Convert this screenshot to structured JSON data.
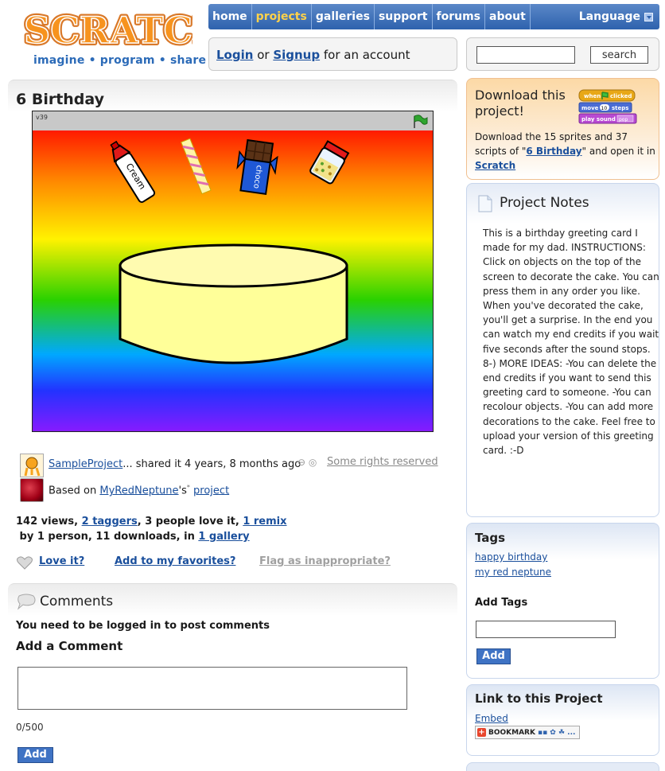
{
  "header": {
    "logo_text": "SCRATCH",
    "tagline": "imagine • program • share",
    "nav": {
      "home": "home",
      "projects": "projects",
      "galleries": "galleries",
      "support": "support",
      "forums": "forums",
      "about": "about",
      "language": "Language"
    },
    "login_link": "Login",
    "or_text": " or ",
    "signup_link": "Signup",
    "account_text": " for an account",
    "search_button": "search"
  },
  "project": {
    "title": "6 Birthday",
    "stage_version": "v39",
    "sprite_labels": {
      "cream": "Cream",
      "chocolate": "choco"
    },
    "share": {
      "user": "SampleProject",
      "ellipsis": "...",
      "shared_text": " shared it 4 years, 8 months ago",
      "rights_icon": "cc-icon",
      "rights_text": "Some rights reserved"
    },
    "based_on": {
      "prefix": "Based on ",
      "user": "MyRedNeptune",
      "possessive": "'s",
      "star": "*",
      "space": " ",
      "project": "project"
    },
    "stats": {
      "views": "142 views, ",
      "taggers": "2 taggers",
      "love": ", 3 people love it, ",
      "remix": "1 remix",
      "remix_rest": " by 1 person, 11 downloads, in ",
      "gallery": "1 gallery"
    },
    "actions": {
      "love": "Love it?",
      "favorites": "Add to my favorites?",
      "flag": "Flag as inappropriate?"
    }
  },
  "comments": {
    "title": "Comments",
    "login_note": "You need to be logged in to post comments",
    "add_title": "Add a Comment",
    "char_count": "0/500",
    "add_button": "Add"
  },
  "sidebar": {
    "download": {
      "title": "Download this project!",
      "blocks": [
        "when",
        "clicked",
        "move",
        "10",
        "steps",
        "play sound",
        "pop"
      ],
      "text_pre": "Download the 15 sprites and 37 scripts of \"",
      "project_link": "6 Birthday",
      "text_mid": "\" and open it in ",
      "scratch_link": "Scratch"
    },
    "notes": {
      "title": "Project Notes",
      "text": "This is a birthday greeting card I made for my dad. INSTRUCTIONS: Click on objects on the top of the screen to decorate the cake. You can press them in any order you like. When you've decorated the cake, you'll get a surprise. In the end you can watch my end credits if you wait five seconds after the sound stops. 8-) MORE IDEAS: -You can delete the end credits if you want to send this greeting card to someone. -You can recolour objects. -You can add more decorations to the cake. Feel free to upload your version of this greeting card. :-D"
    },
    "tags": {
      "title": "Tags",
      "items": [
        "happy birthday",
        "my red neptune"
      ],
      "add_title": "Add Tags",
      "add_button": "Add"
    },
    "link": {
      "title": "Link to this Project",
      "embed": "Embed",
      "bookmark": "BOOKMARK"
    }
  },
  "colors": {
    "nav_bar": "#2e62ad",
    "nav_active": "#ffd24a",
    "link": "#1a4f9c",
    "logo_orange": "#f7931e",
    "button_blue": "#3f73c4"
  }
}
